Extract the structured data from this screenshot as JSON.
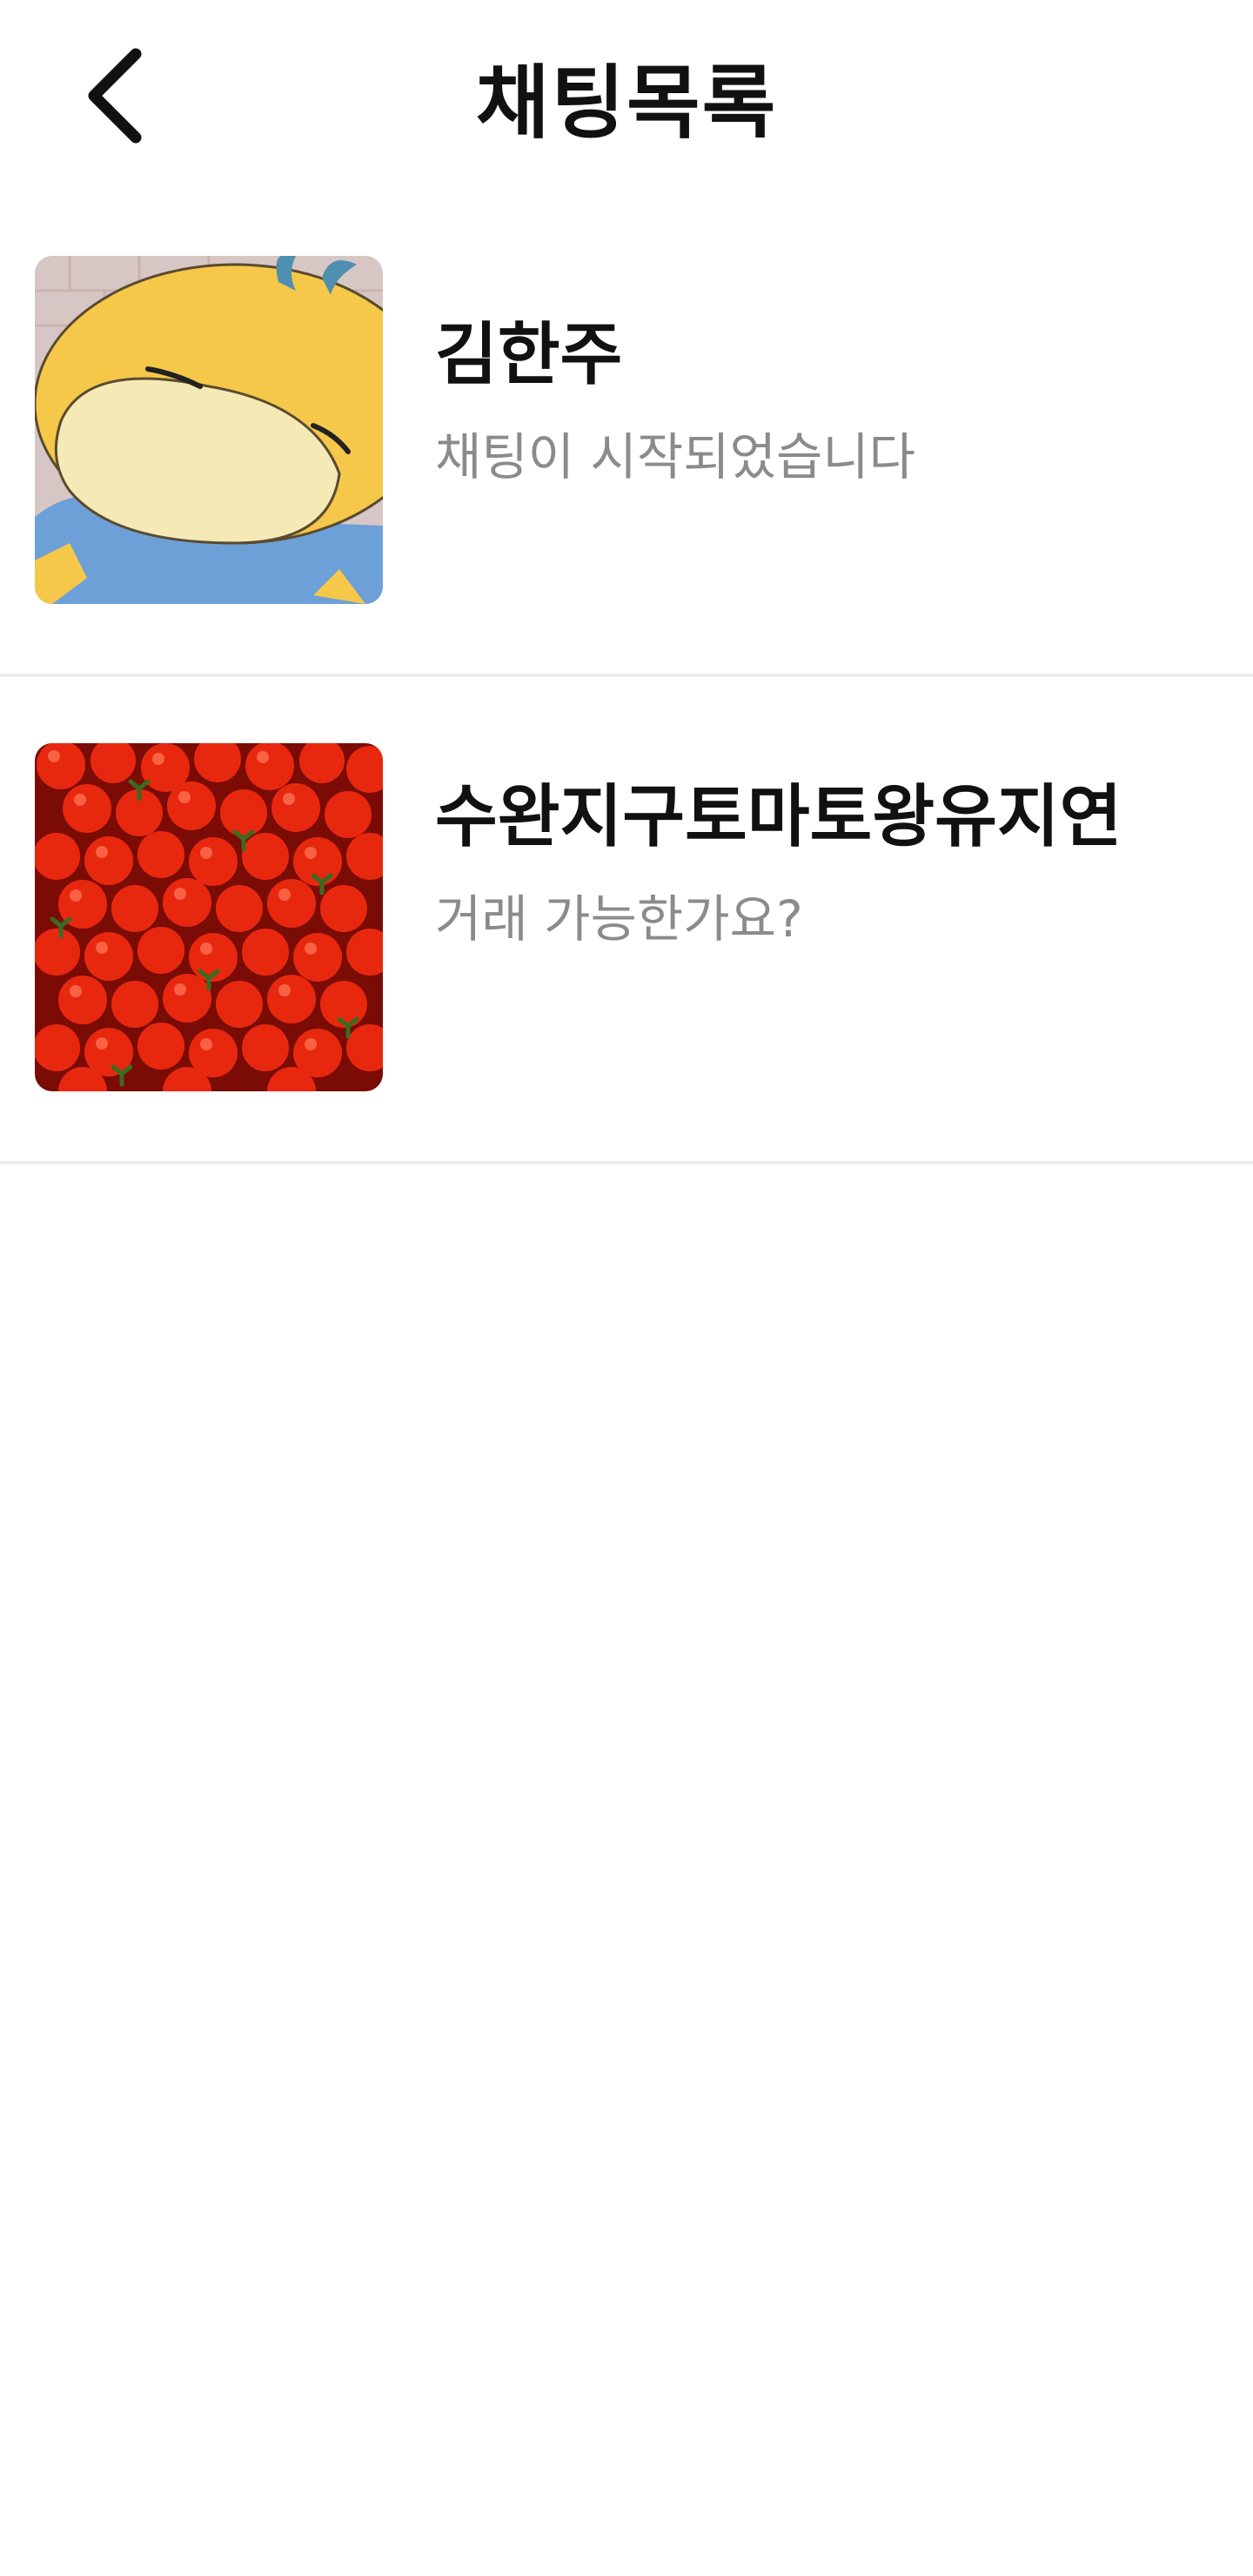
{
  "header": {
    "title": "채팅목록",
    "back_icon": "chevron-left-icon"
  },
  "chats": [
    {
      "name": "김한주",
      "last_message": "채팅이 시작되었습니다",
      "avatar": "psyduck-character-avatar"
    },
    {
      "name": "수완지구토마토왕유지연",
      "last_message": "거래 가능한가요?",
      "avatar": "cherry-tomatoes-photo-avatar"
    }
  ],
  "colors": {
    "title": "#111111",
    "preview_text": "#8b8b8b",
    "divider": "#ececec",
    "background": "#ffffff"
  }
}
